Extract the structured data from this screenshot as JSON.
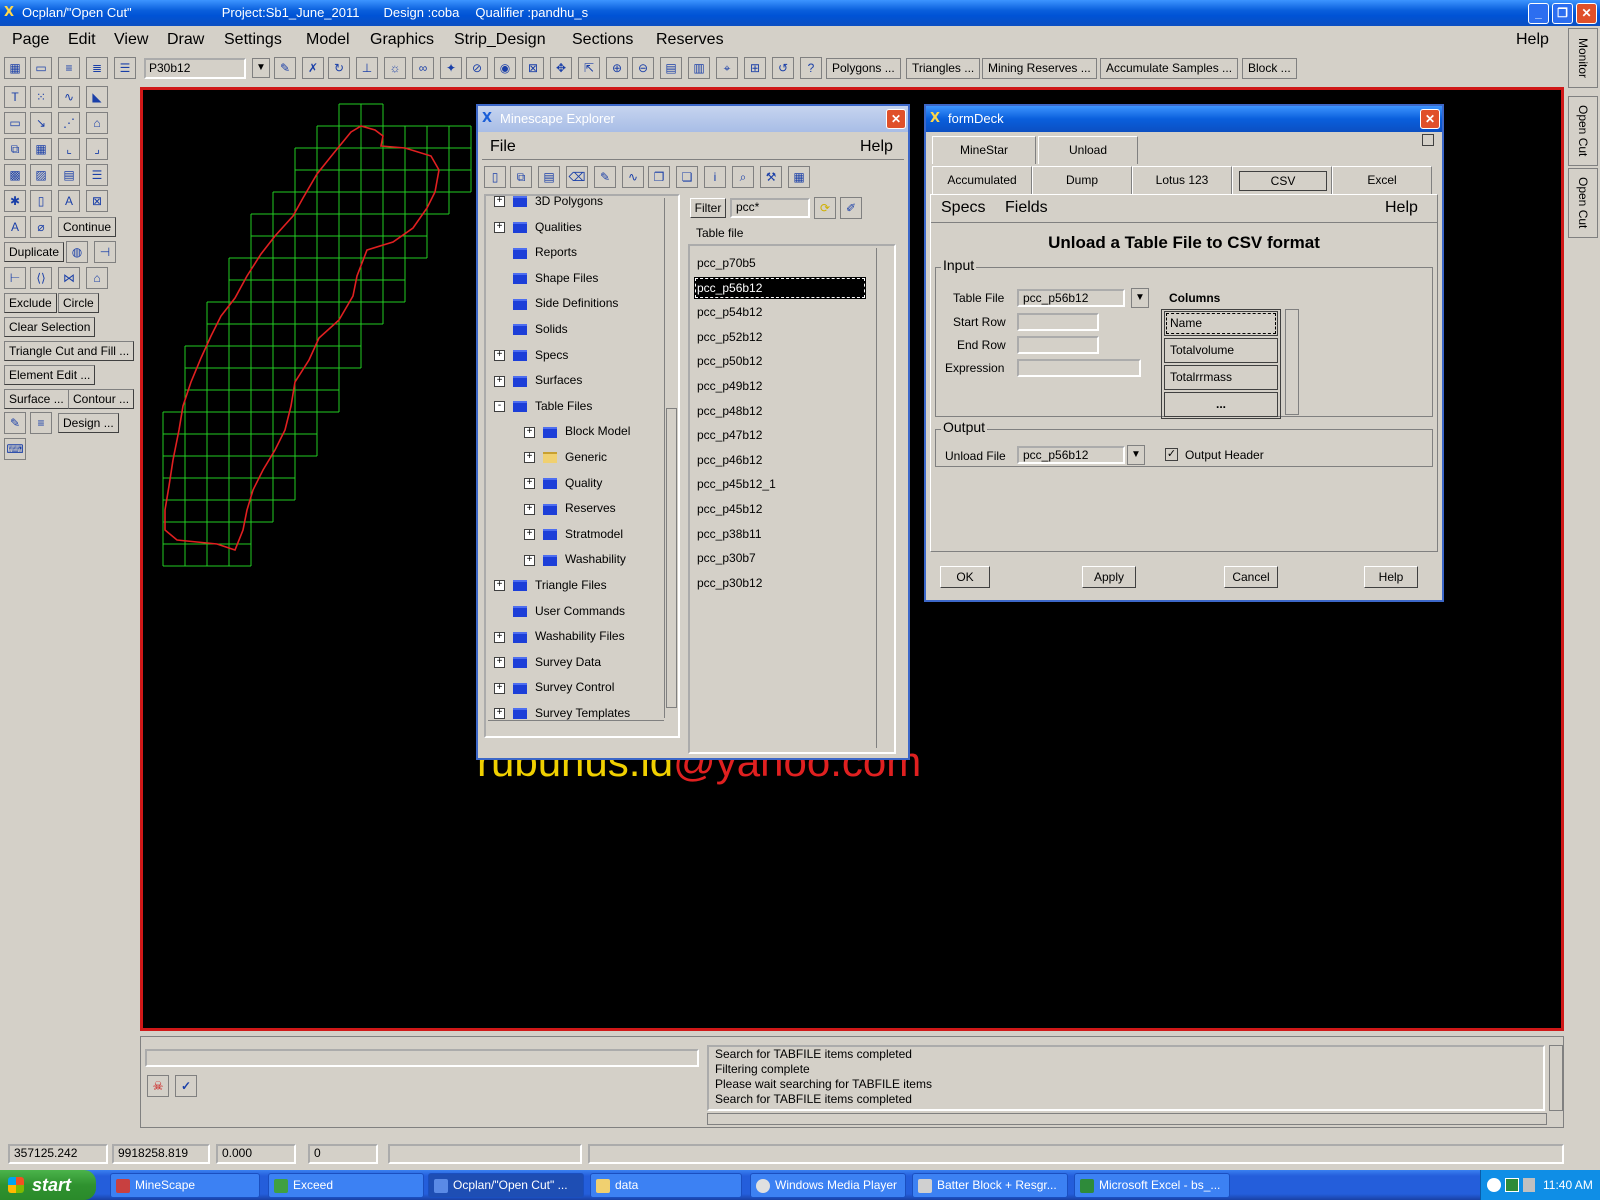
{
  "window": {
    "title": "Ocplan/\"Open Cut\"",
    "project": "Project:Sb1_June_2011",
    "design": "Design :coba",
    "qualifier": "Qualifier :pandhu_s"
  },
  "menu": [
    "Page",
    "Edit",
    "View",
    "Draw",
    "Settings",
    "Model",
    "Graphics",
    "Strip_Design",
    "Sections",
    "Reserves"
  ],
  "menu_help": "Help",
  "toolbar": {
    "combo_value": "P30b12",
    "buttons": [
      "Polygons ...",
      "Triangles ...",
      "Mining Reserves ...",
      "Accumulate Samples ...",
      "Block ..."
    ]
  },
  "left_tools": {
    "continue": "Continue",
    "duplicate": "Duplicate",
    "exclude": "Exclude",
    "circle": "Circle",
    "clear_selection": "Clear Selection",
    "triangle_cut": "Triangle Cut and Fill ...",
    "element_edit": "Element Edit ...",
    "surface": "Surface ...",
    "contour": "Contour ...",
    "design": "Design ..."
  },
  "side_tabs": [
    "Monitor",
    "Open Cut",
    "Open Cut"
  ],
  "explorer": {
    "title": "Minescape Explorer",
    "menu_file": "File",
    "menu_help": "Help",
    "filter_label": "Filter",
    "filter_value": "pcc*",
    "list_header": "Table file",
    "tree": [
      {
        "label": "3D Polygons",
        "level": 0,
        "expander": "+"
      },
      {
        "label": "Qualities",
        "level": 0,
        "expander": "+"
      },
      {
        "label": "Reports",
        "level": 0,
        "expander": ""
      },
      {
        "label": "Shape Files",
        "level": 0,
        "expander": ""
      },
      {
        "label": "Side Definitions",
        "level": 0,
        "expander": ""
      },
      {
        "label": "Solids",
        "level": 0,
        "expander": ""
      },
      {
        "label": "Specs",
        "level": 0,
        "expander": "+"
      },
      {
        "label": "Surfaces",
        "level": 0,
        "expander": "+"
      },
      {
        "label": "Table Files",
        "level": 0,
        "expander": "-"
      },
      {
        "label": "Block Model",
        "level": 1,
        "expander": "+"
      },
      {
        "label": "Generic",
        "level": 1,
        "expander": "+",
        "open": true
      },
      {
        "label": "Quality",
        "level": 1,
        "expander": "+"
      },
      {
        "label": "Reserves",
        "level": 1,
        "expander": "+"
      },
      {
        "label": "Stratmodel",
        "level": 1,
        "expander": "+"
      },
      {
        "label": "Washability",
        "level": 1,
        "expander": "+"
      },
      {
        "label": "Triangle Files",
        "level": 0,
        "expander": "+"
      },
      {
        "label": "User Commands",
        "level": 0,
        "expander": ""
      },
      {
        "label": "Washability Files",
        "level": 0,
        "expander": "+"
      },
      {
        "label": "Survey Data",
        "level": 0,
        "expander": "+"
      },
      {
        "label": "Survey Control",
        "level": 0,
        "expander": "+"
      },
      {
        "label": "Survey Templates",
        "level": 0,
        "expander": "+"
      }
    ],
    "files": [
      "pcc_p70b5",
      "pcc_p56b12",
      "pcc_p54b12",
      "pcc_p52b12",
      "pcc_p50b12",
      "pcc_p49b12",
      "pcc_p48b12",
      "pcc_p47b12",
      "pcc_p46b12",
      "pcc_p45b12_1",
      "pcc_p45b12",
      "pcc_p38b11",
      "pcc_p30b7",
      "pcc_p30b12"
    ],
    "selected_index": 1
  },
  "formdeck": {
    "title": "formDeck",
    "tabs_row1": [
      "MineStar",
      "Unload"
    ],
    "tabs_row2": [
      "Accumulated",
      "Dump",
      "Lotus 123",
      "CSV",
      "Excel"
    ],
    "active_tab": "CSV",
    "sub_specs": "Specs",
    "sub_fields": "Fields",
    "sub_help": "Help",
    "heading": "Unload a Table File to CSV format",
    "input_group": "Input",
    "table_file_label": "Table File",
    "table_file_value": "pcc_p56b12",
    "start_row_label": "Start Row",
    "start_row_value": "",
    "end_row_label": "End Row",
    "end_row_value": "",
    "expression_label": "Expression",
    "expression_value": "",
    "columns_label": "Columns",
    "columns": [
      "Name",
      "Totalvolume",
      "Totalrrmass",
      "..."
    ],
    "output_group": "Output",
    "unload_file_label": "Unload File",
    "unload_file_value": "pcc_p56b12",
    "output_header_label": "Output Header",
    "output_header_checked": true,
    "buttons": {
      "ok": "OK",
      "apply": "Apply",
      "cancel": "Cancel",
      "help": "Help"
    }
  },
  "watermark": "rubunus.id@yahoo.com",
  "status_log": [
    "Search for TABFILE items completed",
    "Filtering complete",
    "Please wait searching for TABFILE items",
    "Search for TABFILE items completed"
  ],
  "coords": {
    "x": "357125.242",
    "y": "9918258.819",
    "z": "0.000",
    "n": "0"
  },
  "taskbar": {
    "start": "start",
    "tasks": [
      "MineScape",
      "Exceed",
      "Ocplan/\"Open Cut\" ...",
      "data",
      "Windows Media Player",
      "Batter Block + Resgr...",
      "Microsoft Excel - bs_..."
    ],
    "active_index": 2,
    "clock": "11:40 AM"
  },
  "colors": {
    "canvas_border": "#d01818",
    "grid": "#22cc22",
    "outline": "#e02020",
    "selection": "#000000"
  }
}
